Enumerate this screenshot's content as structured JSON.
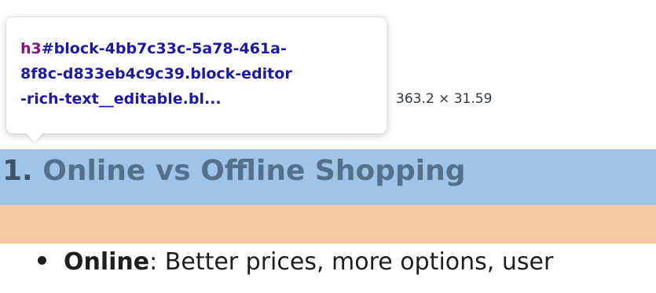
{
  "tooltip": {
    "tag": "h3",
    "selector_line1": "#block-4bb7c33c-5a78-461a-",
    "selector_line2": "8f8c-d833eb4c9c39.block-editor",
    "selector_line3": "-rich-text__editable.bl...",
    "dimensions": "363.2 × 31.59"
  },
  "heading": {
    "number": "1.",
    "text": "Online vs Offline Shopping"
  },
  "list": {
    "items": [
      {
        "strong": "Online",
        "rest": ": Better prices, more options, user"
      }
    ]
  },
  "colors": {
    "content_highlight": "#9fc4e7",
    "margin_highlight": "#f6c89f",
    "tag_color": "#881280",
    "selector_color": "#1a1aa6"
  }
}
